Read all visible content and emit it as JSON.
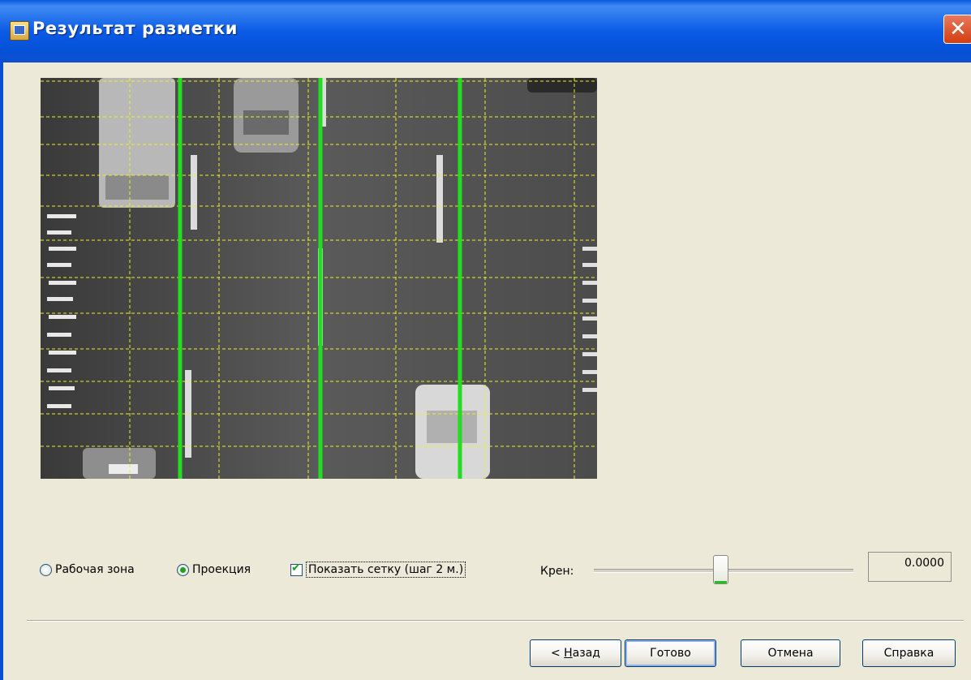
{
  "window": {
    "title": "Результат разметки",
    "close_glyph": "✕",
    "app_icon": "window-icon"
  },
  "options": {
    "work_zone_label": "Рабочая зона",
    "projection_label": "Проекция",
    "selected": "Проекция",
    "show_grid_label": "Показать сетку (шаг 2 м.)",
    "show_grid_checked": true
  },
  "roll": {
    "label": "Крен:",
    "value": "0.0000"
  },
  "buttons": {
    "back_prefix": "< ",
    "back_underlined": "Н",
    "back_rest": "азад",
    "done": "Готово",
    "cancel": "Отмена",
    "help": "Справка"
  },
  "colors": {
    "title_bar": "#0a58e0",
    "lane_lines": "#22dd22",
    "grid_lines": "#f0f020",
    "dialog_bg": "#ece9d8"
  }
}
